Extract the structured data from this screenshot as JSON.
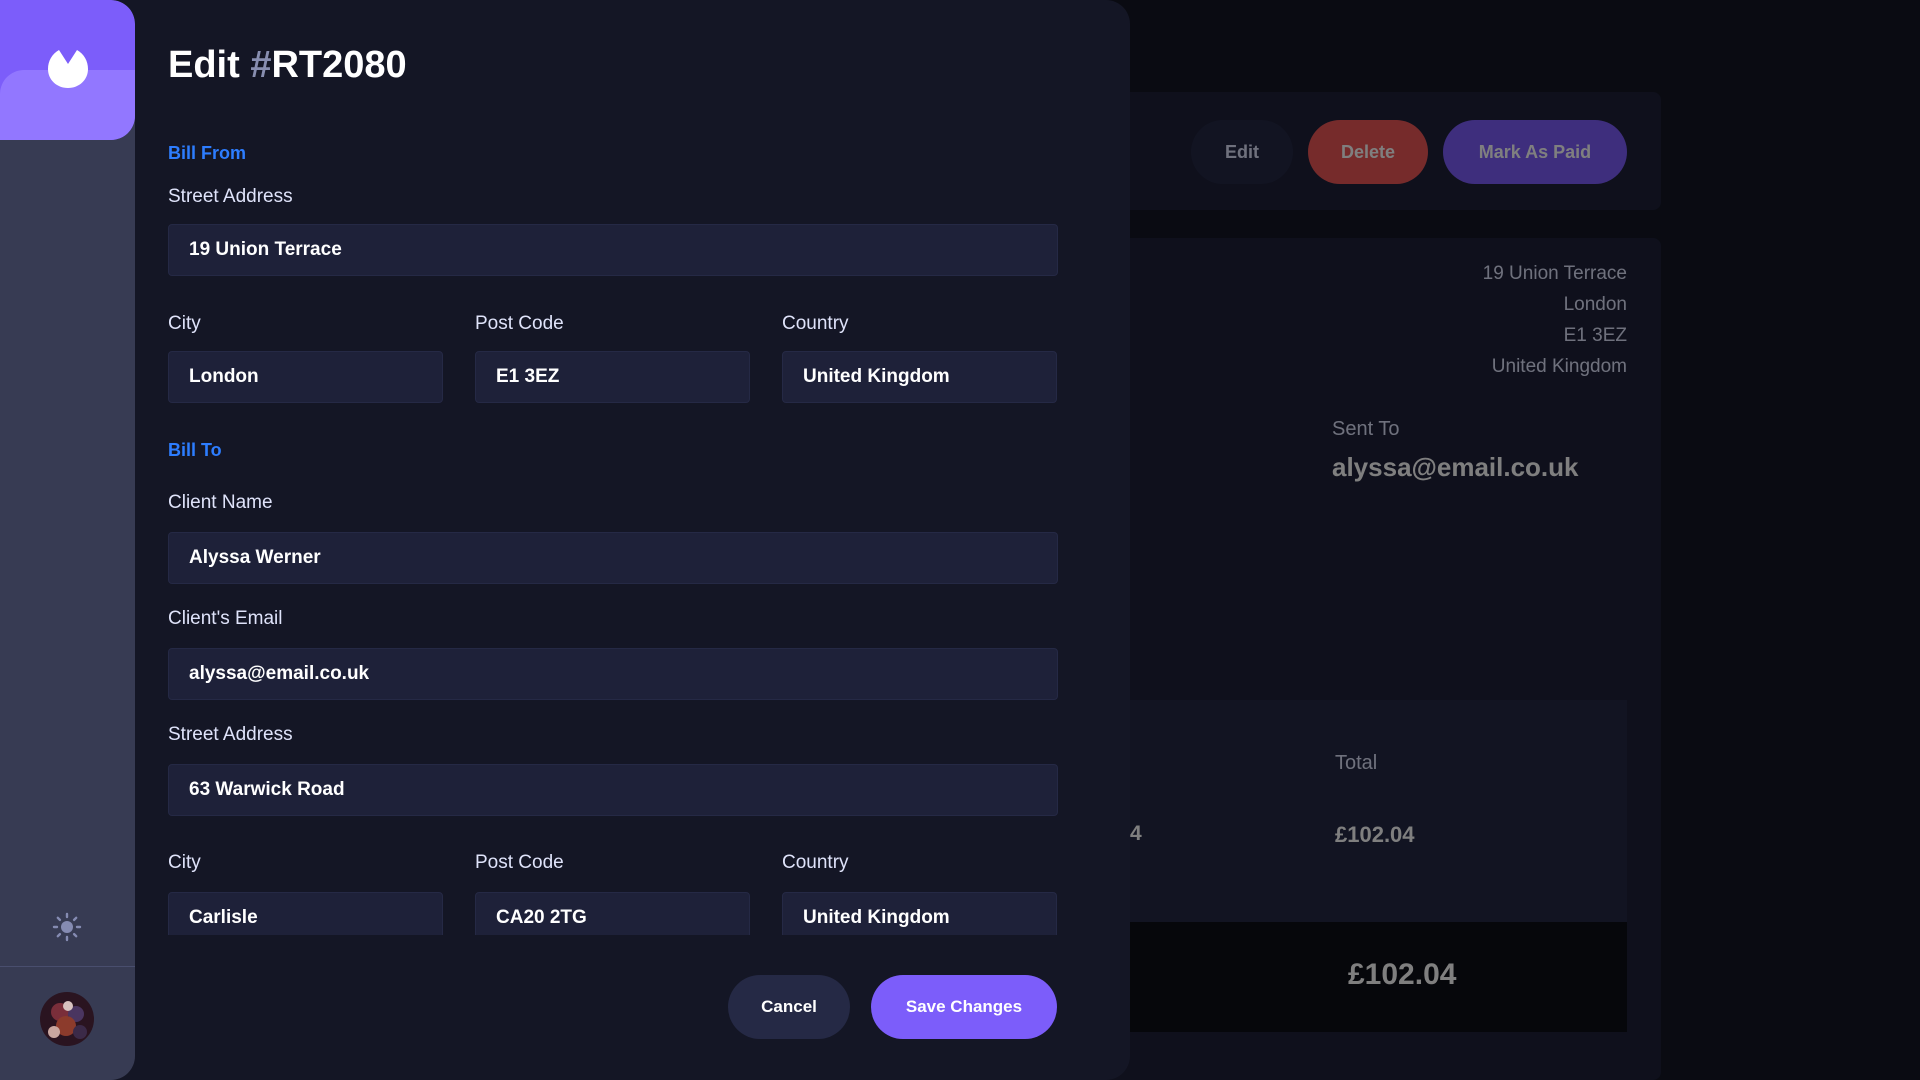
{
  "background": {
    "actions": {
      "edit": "Edit",
      "delete": "Delete",
      "mark_paid": "Mark As Paid"
    },
    "sender_address": [
      "19 Union Terrace",
      "London",
      "E1 3EZ",
      "United Kingdom"
    ],
    "sent_to_label": "Sent To",
    "sent_to_value": "alyssa@email.co.uk",
    "total_label": "Total",
    "qty_partial": "4",
    "item_total": "£102.04",
    "amount_due": "£102.04"
  },
  "drawer": {
    "title_prefix": "Edit ",
    "title_hash": "#",
    "invoice_id": "RT2080",
    "bill_from": {
      "heading": "Bill From",
      "street_label": "Street Address",
      "street": "19 Union Terrace",
      "city_label": "City",
      "city": "London",
      "postcode_label": "Post Code",
      "postcode": "E1 3EZ",
      "country_label": "Country",
      "country": "United Kingdom"
    },
    "bill_to": {
      "heading": "Bill To",
      "client_name_label": "Client Name",
      "client_name": "Alyssa Werner",
      "email_label": "Client's Email",
      "email": "alyssa@email.co.uk",
      "street_label": "Street Address",
      "street": "63 Warwick Road",
      "city_label": "City",
      "city": "Carlisle",
      "postcode_label": "Post Code",
      "postcode": "CA20 2TG",
      "country_label": "Country",
      "country": "United Kingdom"
    },
    "cancel_label": "Cancel",
    "save_label": "Save Changes"
  },
  "sidebar": {
    "logo_icon": "logo-icon",
    "theme_icon": "sun-icon",
    "avatar": "user-avatar"
  }
}
